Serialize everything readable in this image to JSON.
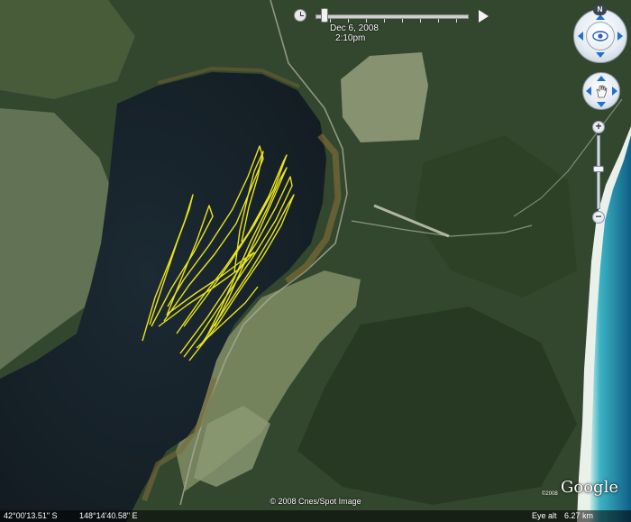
{
  "map": {
    "imagery_type": "satellite",
    "overlay": {
      "track_color": "#f4ee1c",
      "water_color": "#172228",
      "forest_color": "#2c4129"
    }
  },
  "time_slider": {
    "date": "Dec  6, 2008",
    "time": "2:10pm",
    "clock_icon": "clock-icon",
    "play_icon": "play-icon"
  },
  "navigation": {
    "north_label": "N",
    "look_icon": "eye-icon",
    "move_icon": "hand-icon",
    "zoom_in_label": "+",
    "zoom_out_label": "−",
    "zoom_level": 0.45
  },
  "attribution": "© 2008 Cnes/Spot Image",
  "logo": {
    "text": "Google",
    "note": "©2008"
  },
  "status": {
    "latitude": "42°00'13.51\" S",
    "longitude": "148°14'40.58\" E",
    "eye_alt_label": "Eye alt",
    "eye_alt_value": "6.27 km"
  }
}
